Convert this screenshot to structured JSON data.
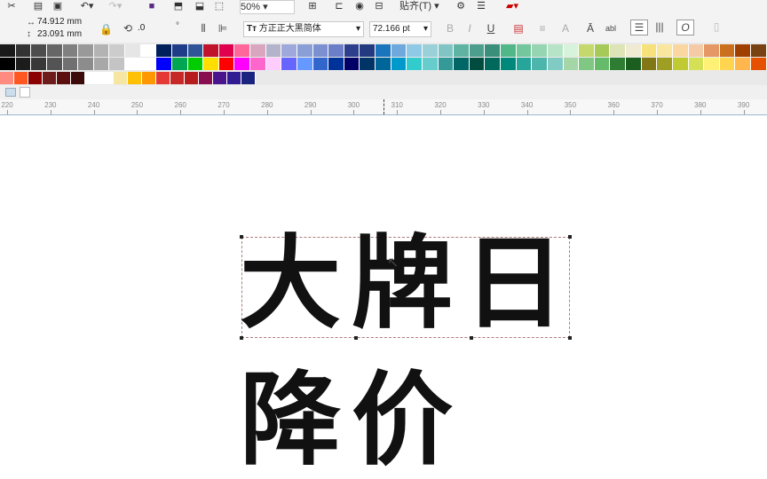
{
  "toolbar": {
    "zoom": "50%",
    "snap_label": "贴齐(T)"
  },
  "propbar": {
    "width_value": "74.912 mm",
    "height_value": "23.091 mm",
    "angle_value": ".0",
    "degree_symbol": "°",
    "font_name": "方正正大黑简体",
    "font_size": "72.166 pt"
  },
  "palette": {
    "row1": [
      "#1a1a1a",
      "#333333",
      "#4d4d4d",
      "#666666",
      "#808080",
      "#999999",
      "#b3b3b3",
      "#cccccc",
      "#e6e6e6",
      "#ffffff",
      "#00205b",
      "#1f3c88",
      "#2e5597",
      "#c0142d",
      "#e0004d",
      "#ff6699",
      "#d9a6bf",
      "#b3b3cc",
      "#9fa8da",
      "#8a9fd6",
      "#7c8fd1",
      "#6a7fc8",
      "#2c3e8c",
      "#233a80",
      "#1b75bc",
      "#6fa8dc",
      "#8ecae6",
      "#9ad0d8",
      "#80c4c4",
      "#5fb3a3",
      "#4d9e8c",
      "#3a8f7a",
      "#52b788",
      "#74c69d",
      "#95d5b2",
      "#b7e4c7",
      "#d8f3dc",
      "#c5d86d",
      "#a7c957",
      "#dde5b6",
      "#f0ead2",
      "#f7e17a",
      "#f9e79f",
      "#fad7a0",
      "#f5cba7",
      "#e59866",
      "#ca6f1e",
      "#a04000",
      "#784212"
    ],
    "row2": [
      "#000000",
      "#1c1c1c",
      "#383838",
      "#545454",
      "#707070",
      "#8c8c8c",
      "#a8a8a8",
      "#c4c4c4",
      "#ffffff",
      "#ffffff",
      "#0000ff",
      "#00a651",
      "#00cc00",
      "#ffde00",
      "#ff0000",
      "#ff00ff",
      "#ff66cc",
      "#ffccff",
      "#6666ff",
      "#6699ff",
      "#3366cc",
      "#003399",
      "#000066",
      "#003366",
      "#006699",
      "#0099cc",
      "#33cccc",
      "#66cccc",
      "#339999",
      "#006666",
      "#004d40",
      "#00695c",
      "#00897b",
      "#26a69a",
      "#4db6ac",
      "#80cbc4",
      "#a5d6a7",
      "#81c784",
      "#66bb6a",
      "#2e7d32",
      "#1b5e20",
      "#827717",
      "#9e9d24",
      "#c0ca33",
      "#d4e157",
      "#fff176",
      "#ffd54f",
      "#ffb74d",
      "#e65100"
    ],
    "row3": [
      "#ff8a80",
      "#ff5722",
      "#8b0000",
      "#6d1b1b",
      "#5b0f0f",
      "#3d0a0a",
      "#ffffff",
      "#ffffff",
      "#f5e6a3",
      "#ffc107",
      "#ff9800",
      "#e53935",
      "#c62828",
      "#b71c1c",
      "#880e4f",
      "#4a148c",
      "#311b92",
      "#1a237e"
    ]
  },
  "ruler": {
    "labels": [
      "220",
      "230",
      "240",
      "250",
      "260",
      "270",
      "280",
      "290",
      "300",
      "310",
      "320",
      "330",
      "340",
      "350",
      "360",
      "370",
      "380",
      "390"
    ]
  },
  "canvas": {
    "line1": "大牌日",
    "line2": "降价"
  }
}
